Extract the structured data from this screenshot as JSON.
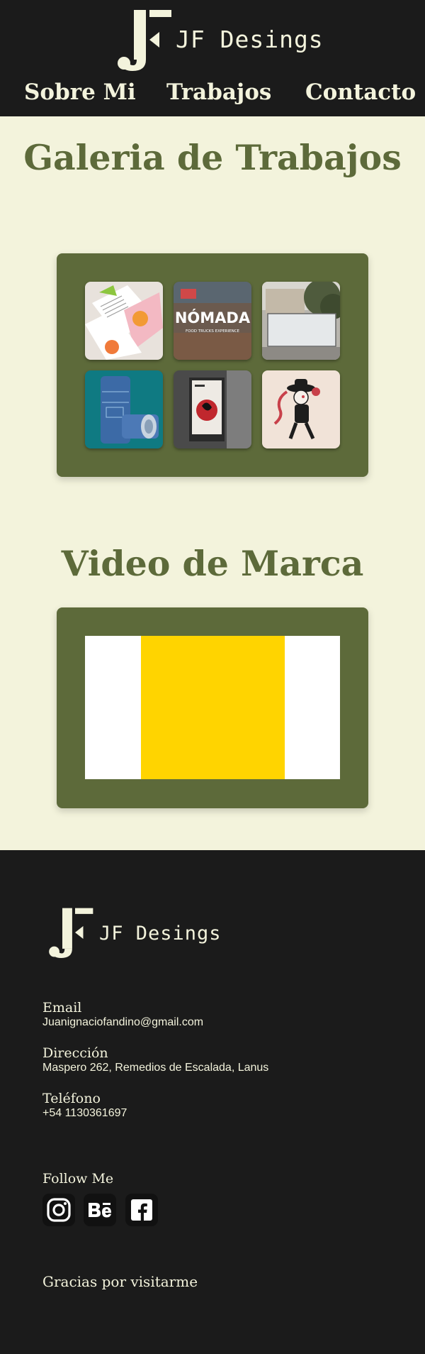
{
  "header": {
    "brand": "JF Desings",
    "nav": [
      {
        "label": "Sobre Mi"
      },
      {
        "label": "Trabajos"
      },
      {
        "label": "Contacto"
      }
    ]
  },
  "gallery": {
    "title": "Galeria de Trabajos",
    "items": [
      {
        "image": "editorial-pages"
      },
      {
        "image": "nomada-food-trucks",
        "text": "NÓMADA",
        "subtext": "FOOD TRUCKS EXPERIENCE"
      },
      {
        "image": "bus-stop-billboard"
      },
      {
        "image": "blue-cans"
      },
      {
        "image": "street-poster"
      },
      {
        "image": "character-illustration"
      }
    ]
  },
  "video": {
    "title": "Video de Marca"
  },
  "footer": {
    "brand": "JF Desings",
    "email_label": "Email",
    "email": "Juanignaciofandino@gmail.com",
    "address_label": "Dirección",
    "address": "Maspero 262, Remedios de Escalada, Lanus",
    "phone_label": "Teléfono",
    "phone": "+54 1130361697",
    "follow_label": "Follow Me",
    "social": [
      "instagram-icon",
      "behance-icon",
      "facebook-icon"
    ],
    "thanks": "Gracias por visitarme"
  },
  "colors": {
    "dark": "#1b1b1b",
    "cream": "#f3f3dc",
    "olive": "#5d6a3a",
    "video_yellow": "#ffd400"
  }
}
